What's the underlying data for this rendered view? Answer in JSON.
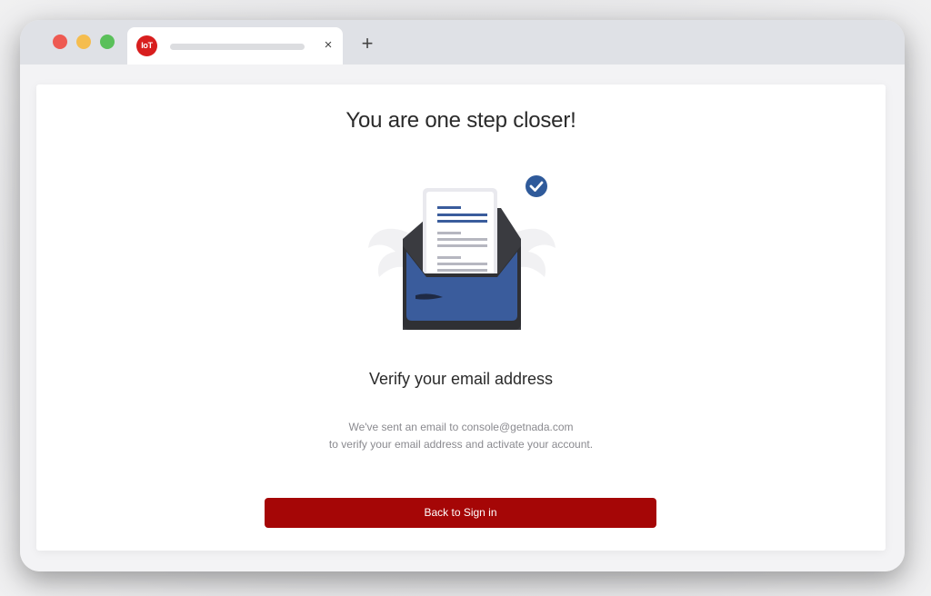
{
  "browser": {
    "tab": {
      "favicon_text": "IoT",
      "favicon_color": "#d81e1e",
      "close_icon": "×"
    },
    "new_tab_icon": "+"
  },
  "verify_page": {
    "heading": "You are one step closer!",
    "illustration": "envelope-with-document-checkmark",
    "subheading": "Verify your email address",
    "message_line1": "We've sent an email to console@getnada.com",
    "message_line2": "to verify your email address and activate your account.",
    "button_label": "Back to Sign in",
    "accent_color": "#a50606",
    "icon_accent": "#3a5c9c"
  }
}
